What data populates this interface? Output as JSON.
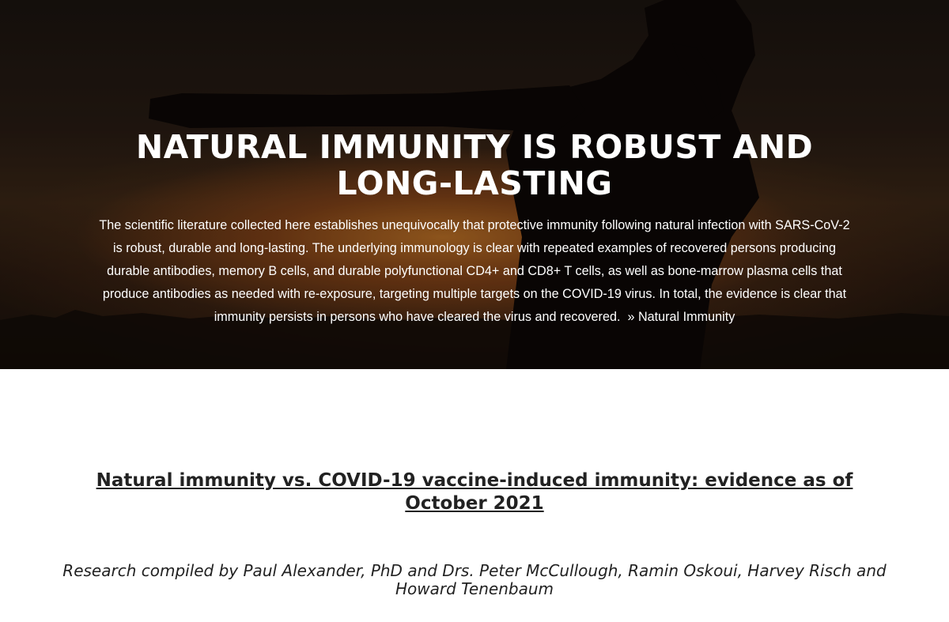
{
  "hero": {
    "title": "NATURAL IMMUNITY IS ROBUST AND LONG-LASTING",
    "description": "The scientific literature collected here establishes unequivocally that protective immunity following natural infection with SARS-CoV-2 is robust, durable and long-lasting. The underlying immunology is clear with repeated examples of recovered persons producing durable antibodies, memory B cells, and durable polyfunctional CD4+ and CD8+ T cells, as well as bone-marrow plasma cells that produce antibodies as needed with re-exposure, targeting multiple targets on the COVID-19 virus. In total, the evidence is clear that immunity persists in persons who have cleared the virus and recovered.",
    "link_label": "» Natural Immunity",
    "background_image": "sunset-silhouette"
  },
  "article": {
    "title": "Natural immunity vs. COVID-19 vaccine-induced immunity: evidence as of October 2021",
    "byline": "Research compiled by Paul Alexander, PhD and Drs. Peter McCullough, Ramin Oskoui, Harvey Risch and Howard Tenenbaum"
  },
  "colors": {
    "hero_text": "#ffffff",
    "body_text": "#222222",
    "page_background": "#ffffff",
    "sunset_glow": "#c87828"
  }
}
